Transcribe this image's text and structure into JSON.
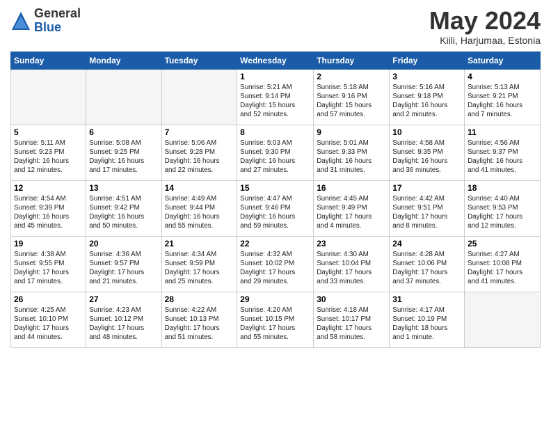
{
  "logo": {
    "general": "General",
    "blue": "Blue"
  },
  "title": "May 2024",
  "location": "Kiili, Harjumaa, Estonia",
  "headers": [
    "Sunday",
    "Monday",
    "Tuesday",
    "Wednesday",
    "Thursday",
    "Friday",
    "Saturday"
  ],
  "weeks": [
    [
      {
        "day": "",
        "info": ""
      },
      {
        "day": "",
        "info": ""
      },
      {
        "day": "",
        "info": ""
      },
      {
        "day": "1",
        "info": "Sunrise: 5:21 AM\nSunset: 9:14 PM\nDaylight: 15 hours\nand 52 minutes."
      },
      {
        "day": "2",
        "info": "Sunrise: 5:18 AM\nSunset: 9:16 PM\nDaylight: 15 hours\nand 57 minutes."
      },
      {
        "day": "3",
        "info": "Sunrise: 5:16 AM\nSunset: 9:18 PM\nDaylight: 16 hours\nand 2 minutes."
      },
      {
        "day": "4",
        "info": "Sunrise: 5:13 AM\nSunset: 9:21 PM\nDaylight: 16 hours\nand 7 minutes."
      }
    ],
    [
      {
        "day": "5",
        "info": "Sunrise: 5:11 AM\nSunset: 9:23 PM\nDaylight: 16 hours\nand 12 minutes."
      },
      {
        "day": "6",
        "info": "Sunrise: 5:08 AM\nSunset: 9:25 PM\nDaylight: 16 hours\nand 17 minutes."
      },
      {
        "day": "7",
        "info": "Sunrise: 5:06 AM\nSunset: 9:28 PM\nDaylight: 16 hours\nand 22 minutes."
      },
      {
        "day": "8",
        "info": "Sunrise: 5:03 AM\nSunset: 9:30 PM\nDaylight: 16 hours\nand 27 minutes."
      },
      {
        "day": "9",
        "info": "Sunrise: 5:01 AM\nSunset: 9:33 PM\nDaylight: 16 hours\nand 31 minutes."
      },
      {
        "day": "10",
        "info": "Sunrise: 4:58 AM\nSunset: 9:35 PM\nDaylight: 16 hours\nand 36 minutes."
      },
      {
        "day": "11",
        "info": "Sunrise: 4:56 AM\nSunset: 9:37 PM\nDaylight: 16 hours\nand 41 minutes."
      }
    ],
    [
      {
        "day": "12",
        "info": "Sunrise: 4:54 AM\nSunset: 9:39 PM\nDaylight: 16 hours\nand 45 minutes."
      },
      {
        "day": "13",
        "info": "Sunrise: 4:51 AM\nSunset: 9:42 PM\nDaylight: 16 hours\nand 50 minutes."
      },
      {
        "day": "14",
        "info": "Sunrise: 4:49 AM\nSunset: 9:44 PM\nDaylight: 16 hours\nand 55 minutes."
      },
      {
        "day": "15",
        "info": "Sunrise: 4:47 AM\nSunset: 9:46 PM\nDaylight: 16 hours\nand 59 minutes."
      },
      {
        "day": "16",
        "info": "Sunrise: 4:45 AM\nSunset: 9:49 PM\nDaylight: 17 hours\nand 4 minutes."
      },
      {
        "day": "17",
        "info": "Sunrise: 4:42 AM\nSunset: 9:51 PM\nDaylight: 17 hours\nand 8 minutes."
      },
      {
        "day": "18",
        "info": "Sunrise: 4:40 AM\nSunset: 9:53 PM\nDaylight: 17 hours\nand 12 minutes."
      }
    ],
    [
      {
        "day": "19",
        "info": "Sunrise: 4:38 AM\nSunset: 9:55 PM\nDaylight: 17 hours\nand 17 minutes."
      },
      {
        "day": "20",
        "info": "Sunrise: 4:36 AM\nSunset: 9:57 PM\nDaylight: 17 hours\nand 21 minutes."
      },
      {
        "day": "21",
        "info": "Sunrise: 4:34 AM\nSunset: 9:59 PM\nDaylight: 17 hours\nand 25 minutes."
      },
      {
        "day": "22",
        "info": "Sunrise: 4:32 AM\nSunset: 10:02 PM\nDaylight: 17 hours\nand 29 minutes."
      },
      {
        "day": "23",
        "info": "Sunrise: 4:30 AM\nSunset: 10:04 PM\nDaylight: 17 hours\nand 33 minutes."
      },
      {
        "day": "24",
        "info": "Sunrise: 4:28 AM\nSunset: 10:06 PM\nDaylight: 17 hours\nand 37 minutes."
      },
      {
        "day": "25",
        "info": "Sunrise: 4:27 AM\nSunset: 10:08 PM\nDaylight: 17 hours\nand 41 minutes."
      }
    ],
    [
      {
        "day": "26",
        "info": "Sunrise: 4:25 AM\nSunset: 10:10 PM\nDaylight: 17 hours\nand 44 minutes."
      },
      {
        "day": "27",
        "info": "Sunrise: 4:23 AM\nSunset: 10:12 PM\nDaylight: 17 hours\nand 48 minutes."
      },
      {
        "day": "28",
        "info": "Sunrise: 4:22 AM\nSunset: 10:13 PM\nDaylight: 17 hours\nand 51 minutes."
      },
      {
        "day": "29",
        "info": "Sunrise: 4:20 AM\nSunset: 10:15 PM\nDaylight: 17 hours\nand 55 minutes."
      },
      {
        "day": "30",
        "info": "Sunrise: 4:18 AM\nSunset: 10:17 PM\nDaylight: 17 hours\nand 58 minutes."
      },
      {
        "day": "31",
        "info": "Sunrise: 4:17 AM\nSunset: 10:19 PM\nDaylight: 18 hours\nand 1 minute."
      },
      {
        "day": "",
        "info": ""
      }
    ]
  ]
}
